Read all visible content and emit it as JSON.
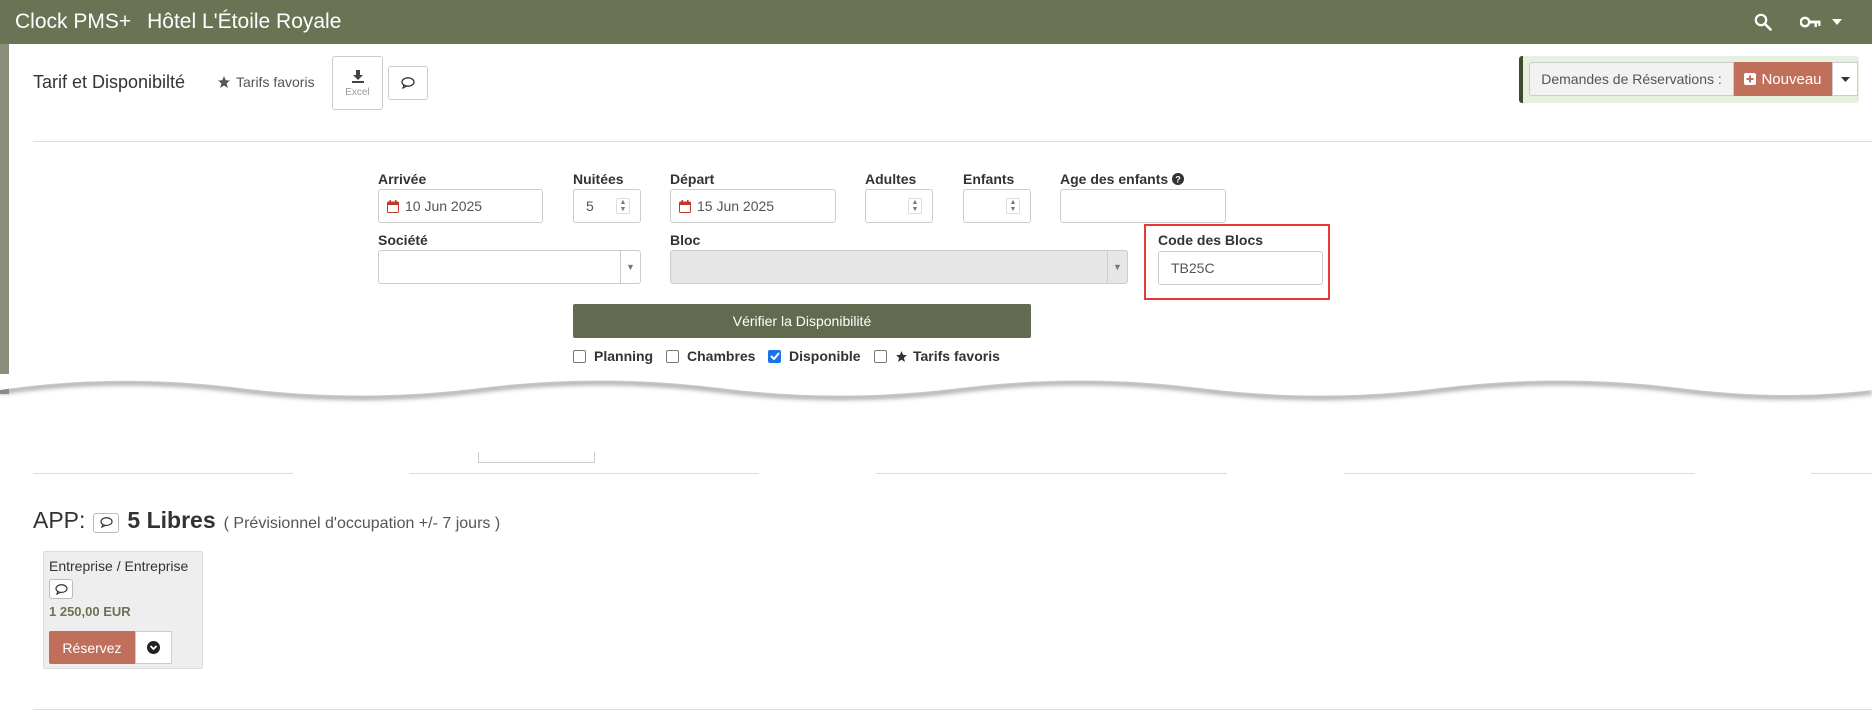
{
  "header": {
    "brand": "Clock PMS+",
    "hotel": "Hôtel L'Étoile Royale",
    "icons": [
      "search-icon",
      "key-icon",
      "caret-down-icon"
    ]
  },
  "toolbar": {
    "page_title": "Tarif et Disponibilté",
    "fav_label": "Tarifs favoris",
    "excel_label": "Excel",
    "resa_label": "Demandes de Réservations :",
    "nouveau_label": "Nouveau"
  },
  "form": {
    "arrivee_label": "Arrivée",
    "arrivee_value": "10 Jun 2025",
    "nuitees_label": "Nuitées",
    "nuitees_value": "5",
    "depart_label": "Départ",
    "depart_value": "15 Jun 2025",
    "adultes_label": "Adultes",
    "adultes_value": "",
    "enfants_label": "Enfants",
    "enfants_value": "",
    "age_label": "Age des enfants",
    "age_value": "",
    "societe_label": "Société",
    "societe_value": "",
    "bloc_label": "Bloc",
    "bloc_value": "",
    "code_label": "Code des Blocs",
    "code_value": "TB25C",
    "verify_label": "Vérifier la Disponibilité",
    "checkboxes": [
      {
        "label": "Planning",
        "checked": false
      },
      {
        "label": "Chambres",
        "checked": false
      },
      {
        "label": "Disponible",
        "checked": true
      },
      {
        "label": "Tarifs favoris",
        "checked": false
      }
    ]
  },
  "result": {
    "room_type": "APP:",
    "free_count": "5 Libres",
    "forecast": "( Prévisionnel d'occupation +/- 7 jours )",
    "card": {
      "title": "Entreprise / Entreprise",
      "price": "1 250,00 EUR",
      "reserve_label": "Réservez"
    }
  },
  "colors": {
    "header_bg": "#6b7355",
    "accent": "#c0705a",
    "verify_bg": "#626b4f",
    "highlight": "#e53935"
  }
}
